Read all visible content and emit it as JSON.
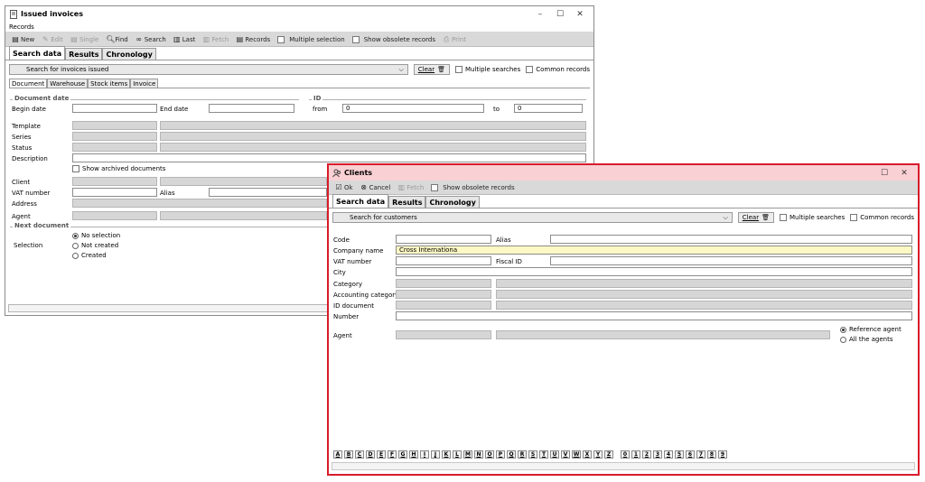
{
  "win1": {
    "title": "Issued invoices",
    "menu": "Records",
    "toolbar": [
      {
        "label": "New",
        "icon": "new-icon",
        "enabled": true
      },
      {
        "label": "Edit",
        "icon": "edit-icon",
        "enabled": false
      },
      {
        "label": "Single",
        "icon": "single-icon",
        "enabled": false
      },
      {
        "label": "Find",
        "icon": "search-icon",
        "enabled": true
      },
      {
        "label": "Search",
        "icon": "binoculars-icon",
        "enabled": true
      },
      {
        "label": "Last",
        "icon": "last-icon",
        "enabled": true
      },
      {
        "label": "Fetch",
        "icon": "fetch-icon",
        "enabled": false
      },
      {
        "label": "Records",
        "icon": "records-icon",
        "enabled": true
      }
    ],
    "multiple_selection": "Multiple selection",
    "show_obsolete": "Show obsolete records",
    "print": "Print",
    "tabs": [
      "Search data",
      "Results",
      "Chronology"
    ],
    "search_combo": "Search for invoices issued",
    "clear": "Clear",
    "multiple_searches": "Multiple searches",
    "common_records": "Common records",
    "subtabs": [
      "Document",
      "Warehouse",
      "Stock items",
      "Invoice"
    ],
    "document_date": "Document date",
    "begin_date": "Begin date",
    "end_date": "End date",
    "id_group": "ID",
    "from": "from",
    "to": "to",
    "from_value": "0",
    "to_value": "0",
    "template": "Template",
    "series": "Series",
    "status": "Status",
    "description": "Description",
    "show_archived": "Show archived documents",
    "client": "Client",
    "vat_number": "VAT number",
    "alias": "Alias",
    "address": "Address",
    "agent": "Agent",
    "next_document": "Next document",
    "selection": "Selection",
    "radios": [
      "No selection",
      "Not created",
      "Created"
    ]
  },
  "win2": {
    "title": "Clients",
    "toolbar": {
      "ok": "Ok",
      "cancel": "Cancel",
      "fetch": "Fetch",
      "show_obsolete": "Show obsolete records"
    },
    "tabs": [
      "Search data",
      "Results",
      "Chronology"
    ],
    "search_combo": "Search for customers",
    "clear": "Clear",
    "multiple_searches": "Multiple searches",
    "common_records": "Common records",
    "fields": {
      "code": "Code",
      "alias": "Alias",
      "company_name": "Company name",
      "company_name_value": "Cross Internationa",
      "vat_number": "VAT number",
      "fiscal_id": "Fiscal ID",
      "city": "City",
      "category": "Category",
      "accounting_category": "Accounting category",
      "id_document": "ID document",
      "number": "Number",
      "agent": "Agent"
    },
    "agent_radios": [
      "Reference agent",
      "All the agents"
    ],
    "letters": [
      "A",
      "B",
      "C",
      "D",
      "E",
      "F",
      "G",
      "H",
      "I",
      "J",
      "K",
      "L",
      "M",
      "N",
      "O",
      "P",
      "Q",
      "R",
      "S",
      "T",
      "U",
      "V",
      "W",
      "X",
      "Y",
      "Z"
    ],
    "digits": [
      "0",
      "1",
      "2",
      "3",
      "4",
      "5",
      "6",
      "7",
      "8",
      "9"
    ]
  }
}
